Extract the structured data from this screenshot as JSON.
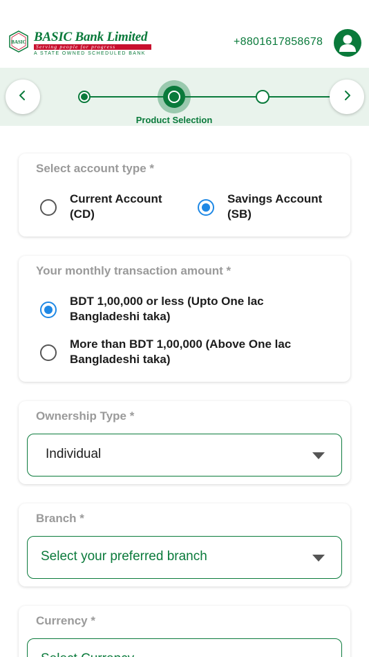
{
  "header": {
    "bank_name": "BASIC Bank Limited",
    "tagline": "Serving people for progress",
    "subtitle": "A STATE OWNED SCHEDULED BANK",
    "seal_text": "BASIC",
    "phone": "+8801617858678",
    "avatar_icon": "user-icon"
  },
  "stepper": {
    "prev_icon": "chevron-left-icon",
    "next_icon": "chevron-right-icon",
    "current_step_label": "Product Selection",
    "current_step": 2,
    "total_visible_steps": 3
  },
  "account_type": {
    "title": "Select account type *",
    "options": [
      {
        "line1": "Current Account",
        "line2": "(CD)",
        "selected": false
      },
      {
        "line1": "Savings Account",
        "line2": "(SB)",
        "selected": true
      }
    ]
  },
  "transaction": {
    "title": "Your monthly transaction amount *",
    "options": [
      {
        "line1": "BDT 1,00,000 or less (Upto One lac",
        "line2": "Bangladeshi taka)",
        "selected": true
      },
      {
        "line1": "More than BDT 1,00,000 (Above One lac",
        "line2": "Bangladeshi taka)",
        "selected": false
      }
    ]
  },
  "ownership": {
    "title": "Ownership Type *",
    "value": "Individual"
  },
  "branch": {
    "title": "Branch *",
    "placeholder": "Select your preferred branch"
  },
  "currency": {
    "title": "Currency *",
    "placeholder": "Select Currency"
  },
  "colors": {
    "brand_green": "#0a7a3b",
    "brand_red": "#c8102e",
    "radio_blue": "#1e88e5",
    "stepper_bg": "#e9f3ec"
  }
}
